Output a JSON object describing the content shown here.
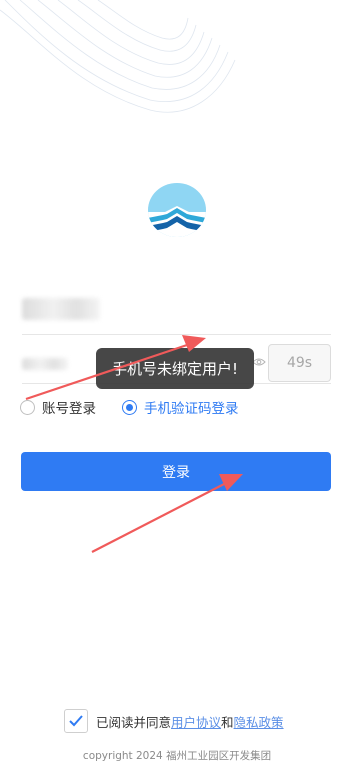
{
  "colors": {
    "accent": "#2f7bf3",
    "arrow": "#f05a5a",
    "toast_bg": "#373737"
  },
  "login_form": {
    "phone_value": "",
    "code_value": "",
    "countdown": "49s"
  },
  "login_type": {
    "account_label": "账号登录",
    "sms_label": "手机验证码登录",
    "selected": "sms"
  },
  "login_button": {
    "label": "登录"
  },
  "toast": {
    "message": "手机号未绑定用户!"
  },
  "agreement": {
    "checked": true,
    "prefix": "已阅读并同意",
    "user_agreement": "用户协议",
    "and": "和",
    "privacy_policy": "隐私政策"
  },
  "footer": {
    "copyright": "copyright 2024 福州工业园区开发集团"
  },
  "icons": {
    "logo": "wave-logo-icon",
    "eye": "eye-icon",
    "check": "check-icon"
  }
}
